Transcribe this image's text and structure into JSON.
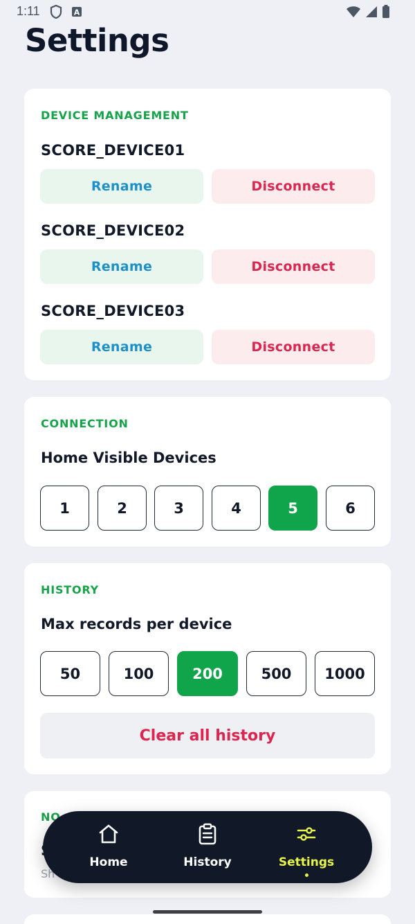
{
  "status_bar": {
    "time": "1:11",
    "a_icon": "A"
  },
  "page_title": "Settings",
  "device_management": {
    "label": "DEVICE MANAGEMENT",
    "devices": [
      {
        "name": "SCORE_DEVICE01",
        "rename_label": "Rename",
        "disconnect_label": "Disconnect"
      },
      {
        "name": "SCORE_DEVICE02",
        "rename_label": "Rename",
        "disconnect_label": "Disconnect"
      },
      {
        "name": "SCORE_DEVICE03",
        "rename_label": "Rename",
        "disconnect_label": "Disconnect"
      }
    ]
  },
  "connection": {
    "label": "CONNECTION",
    "heading": "Home Visible Devices",
    "options": [
      "1",
      "2",
      "3",
      "4",
      "5",
      "6"
    ],
    "selected": "5"
  },
  "history": {
    "label": "HISTORY",
    "heading": "Max records per device",
    "options": [
      "50",
      "100",
      "200",
      "500",
      "1000"
    ],
    "selected": "200",
    "clear_label": "Clear all history"
  },
  "notifications_partial": {
    "label_visible": "NO",
    "heading_visible": "S",
    "sub_visible": "Sh"
  },
  "bottom_nav": {
    "items": [
      {
        "label": "Home",
        "icon": "home-icon"
      },
      {
        "label": "History",
        "icon": "clipboard-icon"
      },
      {
        "label": "Settings",
        "icon": "sliders-icon"
      }
    ],
    "active": "Settings",
    "active_color": "#e7f34a"
  },
  "colors": {
    "accent_green": "#10a44b",
    "section_green": "#16a34a",
    "danger": "#dc2650",
    "rename_blue": "#1e90c8",
    "nav_bg": "#111827"
  }
}
